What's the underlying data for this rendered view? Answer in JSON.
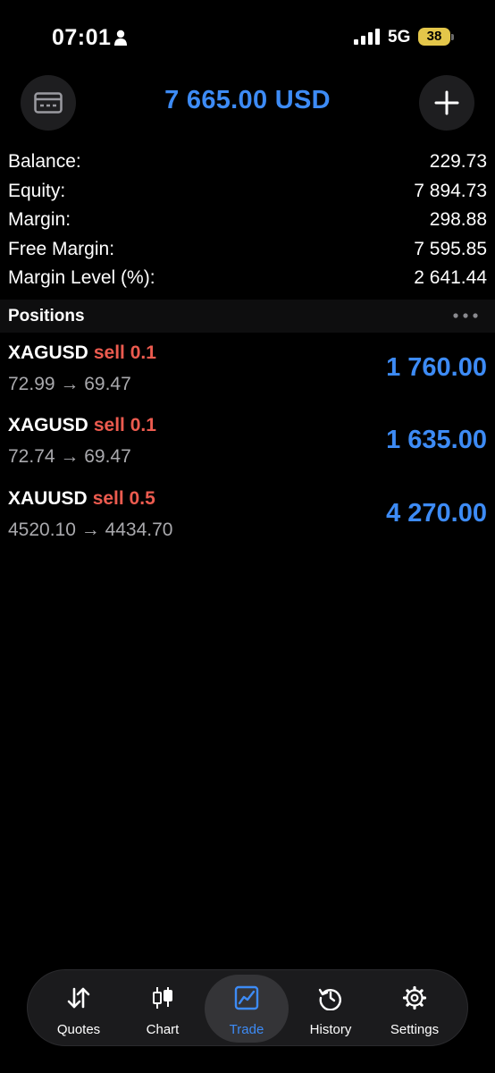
{
  "status_bar": {
    "time": "07:01",
    "network": "5G",
    "battery": "38",
    "icons": [
      "person-icon",
      "signal-icon",
      "battery-icon"
    ]
  },
  "header": {
    "title": "7 665.00 USD",
    "left_icon": "card-icon",
    "right_icon": "plus-icon"
  },
  "summary": {
    "balance_label": "Balance:",
    "balance_value": "229.73",
    "equity_label": "Equity:",
    "equity_value": "7 894.73",
    "margin_label": "Margin:",
    "margin_value": "298.88",
    "free_margin_label": "Free Margin:",
    "free_margin_value": "7 595.85",
    "margin_level_label": "Margin Level (%):",
    "margin_level_value": "2 641.44"
  },
  "positions": {
    "title": "Positions",
    "items": [
      {
        "symbol": "XAGUSD",
        "side": "sell 0.1",
        "prices": "72.99 → 69.47",
        "profit": "1 760.00"
      },
      {
        "symbol": "XAGUSD",
        "side": "sell 0.1",
        "prices": "72.74 → 69.47",
        "profit": "1 635.00"
      },
      {
        "symbol": "XAUUSD",
        "side": "sell 0.5",
        "prices": "4520.10 → 4434.70",
        "profit": "4 270.00"
      }
    ]
  },
  "tabbar": {
    "tabs": [
      {
        "label": "Quotes",
        "icon": "quotes-icon"
      },
      {
        "label": "Chart",
        "icon": "candlestick-icon"
      },
      {
        "label": "Trade",
        "icon": "trade-icon",
        "active": true
      },
      {
        "label": "History",
        "icon": "history-icon"
      },
      {
        "label": "Settings",
        "icon": "settings-gear-icon"
      }
    ]
  },
  "colors": {
    "accent": "#3d8bf5",
    "sell": "#ec5b4f",
    "background": "#000000",
    "battery": "#e3c64a"
  }
}
